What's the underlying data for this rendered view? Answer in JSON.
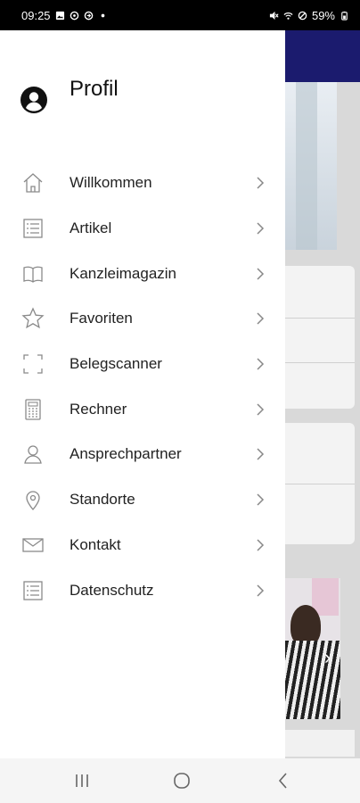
{
  "status_bar": {
    "time": "09:25",
    "battery": "59%",
    "icons": [
      "image-icon",
      "settings-icon",
      "sync-icon",
      "dot-icon",
      "mute-icon",
      "wifi-icon",
      "block-icon",
      "battery-icon"
    ]
  },
  "drawer": {
    "profile_title": "Profil",
    "profile_icon": "account-icon",
    "items": [
      {
        "label": "Willkommen",
        "icon": "home-icon"
      },
      {
        "label": "Artikel",
        "icon": "list-icon"
      },
      {
        "label": "Kanzleimagazin",
        "icon": "book-icon"
      },
      {
        "label": "Favoriten",
        "icon": "star-icon"
      },
      {
        "label": "Belegscanner",
        "icon": "scan-icon"
      },
      {
        "label": "Rechner",
        "icon": "calculator-icon"
      },
      {
        "label": "Ansprechpartner",
        "icon": "person-icon"
      },
      {
        "label": "Standorte",
        "icon": "location-icon"
      },
      {
        "label": "Kontakt",
        "icon": "mail-icon"
      },
      {
        "label": "Datenschutz",
        "icon": "document-icon"
      }
    ]
  },
  "nav_bar": {
    "buttons": [
      "recents-icon",
      "home-icon",
      "back-icon"
    ]
  },
  "colors": {
    "header_background": "#1b1b6e",
    "drawer_background": "#ffffff",
    "icon_gray": "#8a8a8a"
  }
}
